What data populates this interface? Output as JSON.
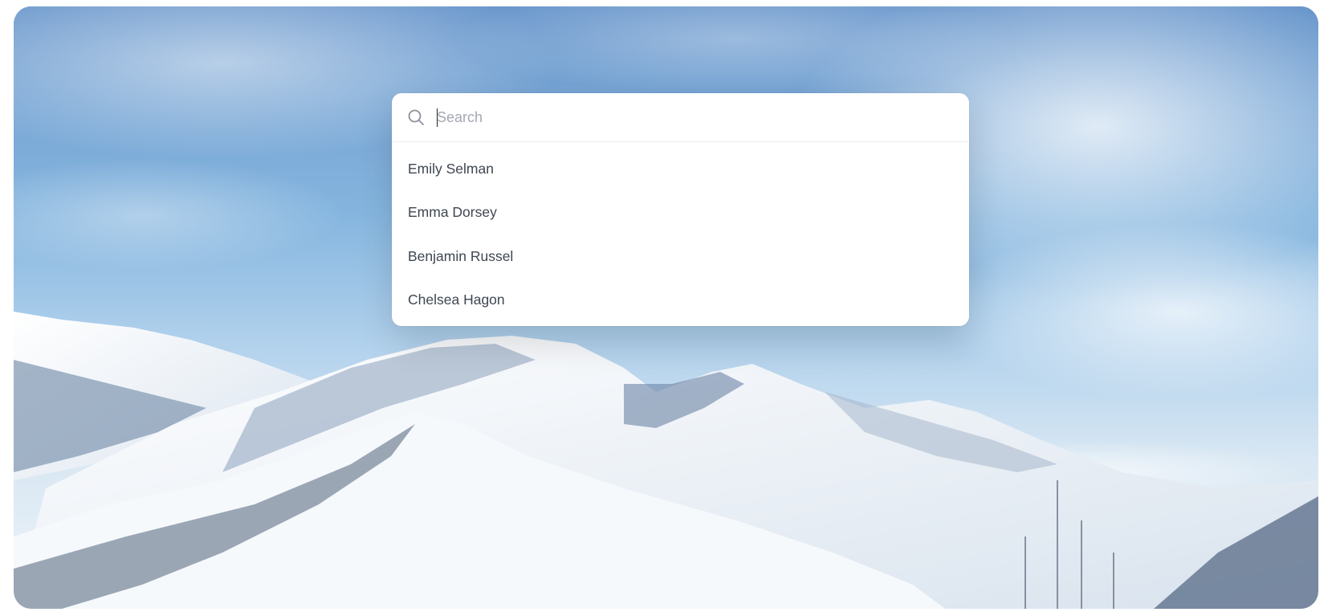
{
  "search": {
    "value": "",
    "placeholder": "Search",
    "icon": "search-icon"
  },
  "results": [
    {
      "label": "Emily Selman"
    },
    {
      "label": "Emma Dorsey"
    },
    {
      "label": "Benjamin Russel"
    },
    {
      "label": "Chelsea Hagon"
    }
  ],
  "colors": {
    "palette_background": "#ffffff",
    "item_text": "#3f4651",
    "placeholder_text": "#a3a8b2",
    "sky_top": "#5f8fc6",
    "snow": "#f4f7fa"
  }
}
